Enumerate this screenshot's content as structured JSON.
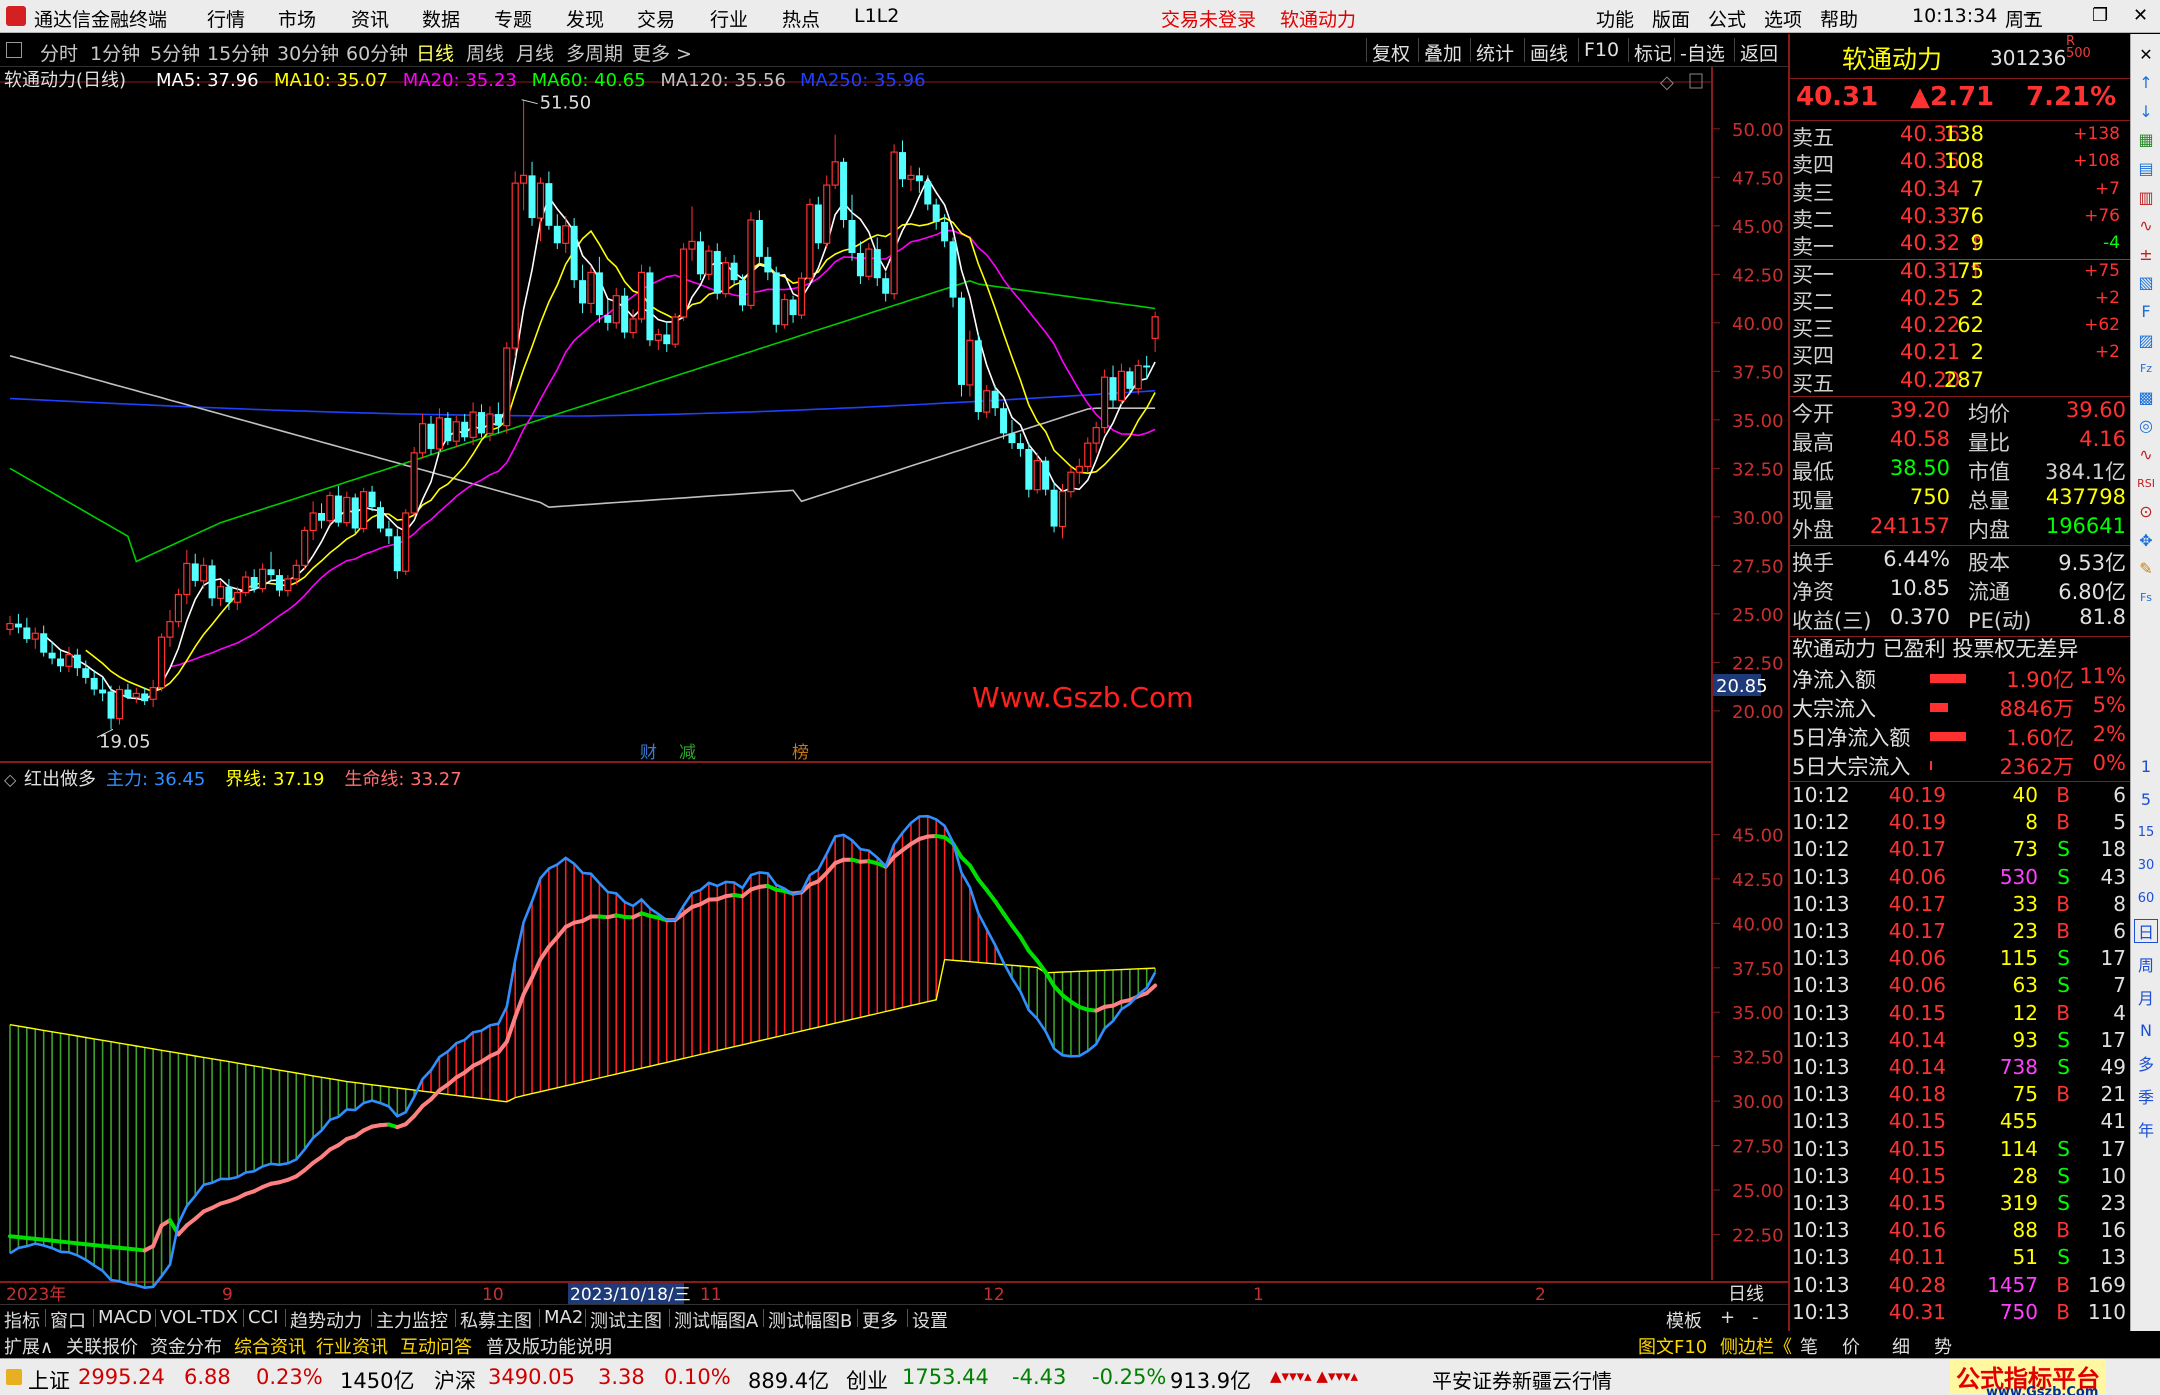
{
  "app": {
    "title": "通达信金融终端",
    "alert1": "交易未登录",
    "alert2": "软通动力",
    "time": "10:13:34",
    "weekday": "周五",
    "menus": [
      "行情",
      "市场",
      "资讯",
      "数据",
      "专题",
      "发现",
      "交易",
      "行业",
      "热点",
      "L1L2"
    ],
    "right_menus": [
      "功能",
      "版面",
      "公式",
      "选项",
      "帮助"
    ],
    "win_min": "─",
    "win_max": "❐",
    "win_close": "✕"
  },
  "periods": [
    "分时",
    "1分钟",
    "5分钟",
    "15分钟",
    "30分钟",
    "60分钟",
    "日线",
    "周线",
    "月线",
    "多周期",
    "更多 >"
  ],
  "active_period": "日线",
  "tools": [
    "复权",
    "叠加",
    "统计",
    "画线",
    "F10",
    "标记",
    "-自选",
    "返回"
  ],
  "main_chart": {
    "title": "软通动力(日线)",
    "ma": [
      {
        "label": "MA5: 37.96",
        "color": "#ffffff"
      },
      {
        "label": "MA10: 35.07",
        "color": "#ffff00"
      },
      {
        "label": "MA20: 35.23",
        "color": "#ff00ff"
      },
      {
        "label": "MA60: 40.65",
        "color": "#00ff00"
      },
      {
        "label": "MA120: 35.56",
        "color": "#c0c0c0"
      },
      {
        "label": "MA250: 35.96",
        "color": "#2040ff"
      }
    ],
    "yticks": [
      "50.00",
      "47.50",
      "45.00",
      "42.50",
      "40.00",
      "37.50",
      "35.00",
      "32.50",
      "30.00",
      "27.50",
      "25.00",
      "22.50",
      "20.00"
    ],
    "high_label": "51.50",
    "low_label": "19.05",
    "price_box": "20.85",
    "watermark": "Www.Gszb.Com",
    "event_tags": [
      {
        "t": "财",
        "c": "#3a7bd5"
      },
      {
        "t": "减",
        "c": "#28a828"
      },
      {
        "t": "榜",
        "c": "#c87814"
      }
    ]
  },
  "sub_chart": {
    "title": "红出做多",
    "lines": [
      {
        "label": "主力: 36.45",
        "color": "#2f8fff"
      },
      {
        "label": "界线: 37.19",
        "color": "#ffff00"
      },
      {
        "label": "生命线: 33.27",
        "color": "#ff7070"
      }
    ],
    "yticks": [
      "45.00",
      "42.50",
      "40.00",
      "37.50",
      "35.00",
      "32.50",
      "30.00",
      "27.50",
      "25.00",
      "22.50"
    ]
  },
  "xaxis": {
    "labels": [
      "2023年",
      "9",
      "10",
      "2023/10/18/三",
      "11",
      "12",
      "1",
      "2"
    ],
    "period": "日线"
  },
  "chart_data": {
    "type": "candlestick",
    "ylim": [
      18.5,
      52
    ],
    "ohlc": [
      [
        24.2,
        24.9,
        23.9,
        24.5
      ],
      [
        24.5,
        25.0,
        24.0,
        24.3
      ],
      [
        24.3,
        24.8,
        23.5,
        23.7
      ],
      [
        23.7,
        24.3,
        23.2,
        24.0
      ],
      [
        24.0,
        24.4,
        22.8,
        23.0
      ],
      [
        23.0,
        23.6,
        22.4,
        22.7
      ],
      [
        22.7,
        23.1,
        22.0,
        22.3
      ],
      [
        22.3,
        23.3,
        22.0,
        22.9
      ],
      [
        22.9,
        23.2,
        21.8,
        22.2
      ],
      [
        22.2,
        22.6,
        21.4,
        21.7
      ],
      [
        21.7,
        22.1,
        20.8,
        21.1
      ],
      [
        21.1,
        21.7,
        20.5,
        20.9
      ],
      [
        21.0,
        21.3,
        19.05,
        19.6
      ],
      [
        19.6,
        21.3,
        19.3,
        21.1
      ],
      [
        21.1,
        21.4,
        20.6,
        20.7
      ],
      [
        20.7,
        21.2,
        20.4,
        20.9
      ],
      [
        20.9,
        21.2,
        20.3,
        20.5
      ],
      [
        20.6,
        21.6,
        20.2,
        21.2
      ],
      [
        21.2,
        24.0,
        21.0,
        23.8
      ],
      [
        23.8,
        25.2,
        23.3,
        24.6
      ],
      [
        24.6,
        26.3,
        24.3,
        26.0
      ],
      [
        26.0,
        28.3,
        25.5,
        27.6
      ],
      [
        27.6,
        28.1,
        26.4,
        26.7
      ],
      [
        26.7,
        27.9,
        26.3,
        27.5
      ],
      [
        27.5,
        27.8,
        25.4,
        25.8
      ],
      [
        25.8,
        26.7,
        25.4,
        26.4
      ],
      [
        26.4,
        26.8,
        25.2,
        25.6
      ],
      [
        25.6,
        26.4,
        25.2,
        26.1
      ],
      [
        26.1,
        27.2,
        25.9,
        26.9
      ],
      [
        26.9,
        27.3,
        26.1,
        26.3
      ],
      [
        26.3,
        27.6,
        26.1,
        27.3
      ],
      [
        27.3,
        28.2,
        26.7,
        27.0
      ],
      [
        27.0,
        27.3,
        25.9,
        26.2
      ],
      [
        26.2,
        27.0,
        25.9,
        26.8
      ],
      [
        26.8,
        27.8,
        26.5,
        27.5
      ],
      [
        27.5,
        29.5,
        27.3,
        29.3
      ],
      [
        29.3,
        30.8,
        28.8,
        30.2
      ],
      [
        30.2,
        30.7,
        29.4,
        29.8
      ],
      [
        29.8,
        31.3,
        29.6,
        31.1
      ],
      [
        31.1,
        31.6,
        29.5,
        29.7
      ],
      [
        29.7,
        31.3,
        29.5,
        31.0
      ],
      [
        31.0,
        31.2,
        29.1,
        29.4
      ],
      [
        29.4,
        31.5,
        29.2,
        31.3
      ],
      [
        31.3,
        31.6,
        30.3,
        30.5
      ],
      [
        30.5,
        30.8,
        29.2,
        29.4
      ],
      [
        29.4,
        29.8,
        28.6,
        29.0
      ],
      [
        29.0,
        29.4,
        26.8,
        27.2
      ],
      [
        27.2,
        30.4,
        27.0,
        30.2
      ],
      [
        30.2,
        33.6,
        30.0,
        33.3
      ],
      [
        33.3,
        35.3,
        33.0,
        34.8
      ],
      [
        34.8,
        35.2,
        33.2,
        33.5
      ],
      [
        33.5,
        35.6,
        33.2,
        35.1
      ],
      [
        35.1,
        35.4,
        33.7,
        33.9
      ],
      [
        33.9,
        35.2,
        33.6,
        34.9
      ],
      [
        34.9,
        35.3,
        33.9,
        34.1
      ],
      [
        34.1,
        35.9,
        33.7,
        35.4
      ],
      [
        35.4,
        35.8,
        34.1,
        34.3
      ],
      [
        34.3,
        35.7,
        33.9,
        35.3
      ],
      [
        35.3,
        35.9,
        34.3,
        34.7
      ],
      [
        34.7,
        39.0,
        34.3,
        38.7
      ],
      [
        38.7,
        47.8,
        38.2,
        47.2
      ],
      [
        47.2,
        51.5,
        45.8,
        47.6
      ],
      [
        47.6,
        48.3,
        45.0,
        45.4
      ],
      [
        45.4,
        47.5,
        44.2,
        47.2
      ],
      [
        47.2,
        47.8,
        44.8,
        45.0
      ],
      [
        45.0,
        45.6,
        43.8,
        44.1
      ],
      [
        44.1,
        45.5,
        43.6,
        45.0
      ],
      [
        45.0,
        45.4,
        41.8,
        42.2
      ],
      [
        42.2,
        43.0,
        40.5,
        41.0
      ],
      [
        41.0,
        42.9,
        40.5,
        42.6
      ],
      [
        42.6,
        43.4,
        40.0,
        40.4
      ],
      [
        40.4,
        41.2,
        39.6,
        40.0
      ],
      [
        40.0,
        41.8,
        39.7,
        41.4
      ],
      [
        41.4,
        41.8,
        39.2,
        39.5
      ],
      [
        39.5,
        40.7,
        39.2,
        40.2
      ],
      [
        40.2,
        43.0,
        40.0,
        42.6
      ],
      [
        42.6,
        42.9,
        38.8,
        39.1
      ],
      [
        39.1,
        39.7,
        38.6,
        39.4
      ],
      [
        39.4,
        40.1,
        38.5,
        38.9
      ],
      [
        38.9,
        40.5,
        38.7,
        40.3
      ],
      [
        40.3,
        44.1,
        40.1,
        43.8
      ],
      [
        43.8,
        46.0,
        43.2,
        44.2
      ],
      [
        44.2,
        44.7,
        42.2,
        42.5
      ],
      [
        42.5,
        44.0,
        42.2,
        43.7
      ],
      [
        43.7,
        44.1,
        41.2,
        41.5
      ],
      [
        41.5,
        43.4,
        41.3,
        43.1
      ],
      [
        43.1,
        43.5,
        42.0,
        42.2
      ],
      [
        42.2,
        42.5,
        40.6,
        40.9
      ],
      [
        40.9,
        45.7,
        40.7,
        45.3
      ],
      [
        45.3,
        45.8,
        43.0,
        43.4
      ],
      [
        43.4,
        43.9,
        42.2,
        42.6
      ],
      [
        42.6,
        42.9,
        39.5,
        39.9
      ],
      [
        39.9,
        41.5,
        39.7,
        41.2
      ],
      [
        41.2,
        41.4,
        40.0,
        40.4
      ],
      [
        40.4,
        42.6,
        40.2,
        42.3
      ],
      [
        42.3,
        46.4,
        42.1,
        46.1
      ],
      [
        46.1,
        46.5,
        43.8,
        44.1
      ],
      [
        44.1,
        47.6,
        43.9,
        47.1
      ],
      [
        47.1,
        49.7,
        46.9,
        48.3
      ],
      [
        48.3,
        48.5,
        44.9,
        45.3
      ],
      [
        45.3,
        46.6,
        43.2,
        43.6
      ],
      [
        43.6,
        44.2,
        42.0,
        42.4
      ],
      [
        42.4,
        44.1,
        42.2,
        43.8
      ],
      [
        43.8,
        44.4,
        41.9,
        42.3
      ],
      [
        42.3,
        42.6,
        41.1,
        41.5
      ],
      [
        41.5,
        49.2,
        41.2,
        48.8
      ],
      [
        48.8,
        49.4,
        47.0,
        47.4
      ],
      [
        47.4,
        48.1,
        46.8,
        47.6
      ],
      [
        47.6,
        48.0,
        46.7,
        47.3
      ],
      [
        47.3,
        47.6,
        45.8,
        46.1
      ],
      [
        46.1,
        46.4,
        44.8,
        45.2
      ],
      [
        45.2,
        45.6,
        43.9,
        44.2
      ],
      [
        44.2,
        44.4,
        40.8,
        41.3
      ],
      [
        41.3,
        41.6,
        36.2,
        36.8
      ],
      [
        36.8,
        39.6,
        36.2,
        39.1
      ],
      [
        39.1,
        39.4,
        35.0,
        35.4
      ],
      [
        35.4,
        36.8,
        35.1,
        36.5
      ],
      [
        36.5,
        36.8,
        35.2,
        35.6
      ],
      [
        35.6,
        35.9,
        34.0,
        34.3
      ],
      [
        34.3,
        35.0,
        33.5,
        33.8
      ],
      [
        33.8,
        34.3,
        33.1,
        33.5
      ],
      [
        33.5,
        33.8,
        31.0,
        31.4
      ],
      [
        31.4,
        33.3,
        31.2,
        32.9
      ],
      [
        32.9,
        33.1,
        31.1,
        31.4
      ],
      [
        31.4,
        31.8,
        29.2,
        29.5
      ],
      [
        29.5,
        31.7,
        28.9,
        31.3
      ],
      [
        31.3,
        32.6,
        31.0,
        32.3
      ],
      [
        32.3,
        33.0,
        31.7,
        32.6
      ],
      [
        32.6,
        34.1,
        32.3,
        33.8
      ],
      [
        33.8,
        34.9,
        33.3,
        34.6
      ],
      [
        34.6,
        37.6,
        34.3,
        37.2
      ],
      [
        37.2,
        37.8,
        35.6,
        36.0
      ],
      [
        36.0,
        37.9,
        35.8,
        37.5
      ],
      [
        37.5,
        37.7,
        36.3,
        36.6
      ],
      [
        36.6,
        38.1,
        36.3,
        37.8
      ],
      [
        37.8,
        38.3,
        37.1,
        37.7
      ],
      [
        39.2,
        40.58,
        38.5,
        40.31
      ]
    ]
  },
  "quote": {
    "name": "软通动力",
    "code": "301236",
    "badge": "R 500",
    "price": "40.31",
    "change": "▲2.71",
    "pct": "7.21%",
    "book": [
      [
        "卖五",
        "40.36",
        "138",
        "+138"
      ],
      [
        "卖四",
        "40.35",
        "108",
        "+108"
      ],
      [
        "卖三",
        "40.34",
        "7",
        "+7"
      ],
      [
        "卖二",
        "40.33",
        "76",
        "+76"
      ],
      [
        "卖一",
        "40.32 ↑",
        "9",
        "-4"
      ],
      [
        "买一",
        "40.31 ↑",
        "75",
        "+75"
      ],
      [
        "买二",
        "40.25",
        "2",
        "+2"
      ],
      [
        "买三",
        "40.22",
        "62",
        "+62"
      ],
      [
        "买四",
        "40.21",
        "2",
        "+2"
      ],
      [
        "买五",
        "40.20",
        "287",
        ""
      ]
    ],
    "stats1": [
      [
        "今开",
        "39.20",
        "均价",
        "39.60"
      ],
      [
        "最高",
        "40.58",
        "量比",
        "4.16"
      ],
      [
        "最低",
        "38.50",
        "市值",
        "384.1亿"
      ],
      [
        "现量",
        "750",
        "总量",
        "437798"
      ],
      [
        "外盘",
        "241157",
        "内盘",
        "196641"
      ]
    ],
    "stats2": [
      [
        "换手",
        "6.44%",
        "股本",
        "9.53亿"
      ],
      [
        "净资",
        "10.85",
        "流通",
        "6.80亿"
      ],
      [
        "收益(三)",
        "0.370",
        "PE(动)",
        "81.8"
      ]
    ],
    "tags_line": "软通动力 已盈利 投票权无差异",
    "flows": [
      [
        "净流入额",
        "1.90亿",
        "11%"
      ],
      [
        "大宗流入",
        "8846万",
        "5%"
      ],
      [
        "5日净流入额",
        "1.60亿",
        "2%"
      ],
      [
        "5日大宗流入",
        "2362万",
        "0%"
      ]
    ],
    "ticks": [
      [
        "10:12",
        "40.19",
        "40",
        "B",
        "6"
      ],
      [
        "10:12",
        "40.19",
        "8",
        "B",
        "5"
      ],
      [
        "10:12",
        "40.17",
        "73",
        "S",
        "18"
      ],
      [
        "10:13",
        "40.06",
        "530",
        "S",
        "43"
      ],
      [
        "10:13",
        "40.17",
        "33",
        "B",
        "8"
      ],
      [
        "10:13",
        "40.17",
        "23",
        "B",
        "6"
      ],
      [
        "10:13",
        "40.06",
        "115",
        "S",
        "17"
      ],
      [
        "10:13",
        "40.06",
        "63",
        "S",
        "7"
      ],
      [
        "10:13",
        "40.15",
        "12",
        "B",
        "4"
      ],
      [
        "10:13",
        "40.14",
        "93",
        "S",
        "17"
      ],
      [
        "10:13",
        "40.14",
        "738",
        "S",
        "49"
      ],
      [
        "10:13",
        "40.18",
        "75",
        "B",
        "21"
      ],
      [
        "10:13",
        "40.15",
        "455",
        "",
        "41"
      ],
      [
        "10:13",
        "40.15",
        "114",
        "S",
        "17"
      ],
      [
        "10:13",
        "40.15",
        "28",
        "S",
        "10"
      ],
      [
        "10:13",
        "40.15",
        "319",
        "S",
        "23"
      ],
      [
        "10:13",
        "40.16",
        "88",
        "B",
        "16"
      ],
      [
        "10:13",
        "40.11",
        "51",
        "S",
        "13"
      ],
      [
        "10:13",
        "40.28",
        "1457",
        "B",
        "169"
      ],
      [
        "10:13",
        "40.31",
        "750",
        "B",
        "110"
      ]
    ]
  },
  "side_icons": [
    "✕",
    "↑",
    "↓",
    "▦",
    "▤",
    "▥",
    "∿",
    "±",
    "▧",
    "F",
    "▨",
    "Fz",
    "▩",
    "◎",
    "∿",
    "RSI",
    "⊙",
    "✥",
    "✎",
    "Fs"
  ],
  "side_periods": [
    "1",
    "5",
    "15",
    "30",
    "60",
    "日",
    "周",
    "月",
    "N",
    "多",
    "季",
    "年"
  ],
  "tabs1": [
    "指标",
    "窗口",
    "MACD",
    "VOL-TDX",
    "CCI",
    "趋势动力",
    "主力监控",
    "私募主图",
    "MA2",
    "测试主图",
    "测试幅图A",
    "测试幅图B",
    "更多",
    "设置"
  ],
  "tabs1_right": [
    "模板",
    "+",
    "-"
  ],
  "tabs2": [
    {
      "t": "扩展∧",
      "c": "#dddddd"
    },
    {
      "t": "关联报价",
      "c": "#dddddd"
    },
    {
      "t": "资金分布",
      "c": "#dddddd"
    },
    {
      "t": "综合资讯",
      "c": "#ffd700"
    },
    {
      "t": "行业资讯",
      "c": "#ffd700"
    },
    {
      "t": "互动问答",
      "c": "#ffd700"
    },
    {
      "t": "普及版功能说明",
      "c": "#dddddd"
    }
  ],
  "tabs2_right": [
    "图文F10",
    "侧边栏《",
    "笔",
    "价",
    "细",
    "势"
  ],
  "status": {
    "idx": [
      {
        "name": "上证",
        "val": "2995.24",
        "chg": "6.88",
        "pct": "0.23%",
        "amt": "1450亿",
        "color": "#d00000"
      },
      {
        "name": "沪深",
        "val": "3490.05",
        "chg": "3.38",
        "pct": "0.10%",
        "amt": "889.4亿",
        "color": "#d00000"
      },
      {
        "name": "创业",
        "val": "1753.44",
        "chg": "-4.43",
        "pct": "-0.25%",
        "amt": "913.9亿",
        "color": "#008000"
      }
    ],
    "ind": "▲▾▾▾▴ ▲▾▾▾▴",
    "server": "平安证券新疆云行情",
    "brand": "公式指标平台",
    "brand_url": "www.Gszb.Com"
  }
}
